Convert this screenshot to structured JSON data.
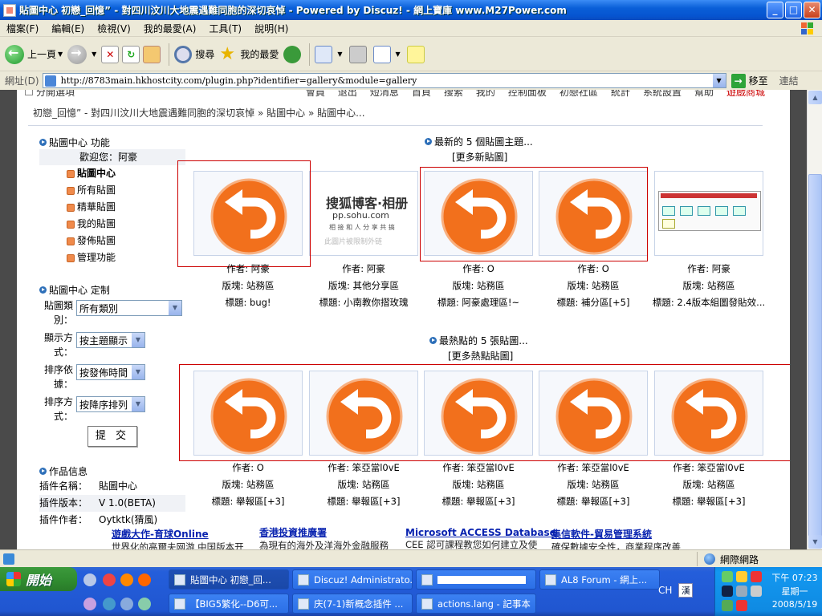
{
  "window": {
    "title": "貼圖中心 初戀_回憶” - 對四川汶川大地震遇難同胞的深切哀悼 - Powered by Discuz! - 網上寶庫 www.M27Power.com",
    "min": "_",
    "max": "□",
    "close": "✕"
  },
  "menu": [
    "檔案(F)",
    "編輯(E)",
    "檢視(V)",
    "我的最愛(A)",
    "工具(T)",
    "說明(H)"
  ],
  "toolbar": {
    "back": "上一頁",
    "search": "搜尋",
    "favorites": "我的最愛"
  },
  "address": {
    "label": "網址(D)",
    "url": "http://8783main.hkhostcity.com/plugin.php?identifier=gallery&module=gallery",
    "go": "移至",
    "links": "連結"
  },
  "topnav": {
    "left": "分開選項",
    "items": [
      "會員",
      "退出",
      "短消息",
      "首頁",
      "搜索",
      "我的",
      "控制面板",
      "初戀社區",
      "統計",
      "系統設置",
      "幫助"
    ],
    "highlight": "遊戲商城"
  },
  "breadcrumb": "初戀_回憶” - 對四川汶川大地震遇難同胞的深切哀悼 » 貼圖中心 » 貼圖中心...",
  "sidebar": {
    "functions_title": "貼圖中心 功能",
    "welcome": "歡迎您：阿豪",
    "links": [
      "貼圖中心",
      "所有貼圖",
      "精華貼圖",
      "我的貼圖",
      "發佈貼圖",
      "管理功能"
    ],
    "custom_title": "貼圖中心 定制",
    "form": [
      {
        "label": "貼圖類別：",
        "value": "所有類別"
      },
      {
        "label": "顯示方式：",
        "value": "按主題顯示"
      },
      {
        "label": "排序依據：",
        "value": "按發佈時間"
      },
      {
        "label": "排序方式：",
        "value": "按降序排列"
      }
    ],
    "submit": "提 交",
    "info_title": "作品信息",
    "info": [
      {
        "k": "插件名稱：",
        "v": "貼圖中心"
      },
      {
        "k": "插件版本：",
        "v": "V 1.0(BETA)"
      },
      {
        "k": "插件作者：",
        "v": "Oytktk(猜風)"
      }
    ]
  },
  "latest": {
    "title": "最新的 5 個貼圖主題...",
    "more": "[更多新貼圖]",
    "items": [
      {
        "author": "作者: 阿豪",
        "board": "版塊: 站務區",
        "subject": "標題: bug!"
      },
      {
        "author": "作者: 阿豪",
        "board": "版塊: 其他分享區",
        "subject": "標題: 小南教你摺玫瑰"
      },
      {
        "author": "作者: O",
        "board": "版塊: 站務區",
        "subject": "標題: 阿豪處理區!~"
      },
      {
        "author": "作者: O",
        "board": "版塊: 站務區",
        "subject": "標題: 補分區[+5]"
      },
      {
        "author": "作者: 阿豪",
        "board": "版塊: 站務區",
        "subject": "標題: 2.4版本組圖發貼效..."
      }
    ],
    "sohu": {
      "l1": "搜狐博客·相册",
      "l2": "pp.sohu.com",
      "l3": "相 接 和 人 分 享 共 搞",
      "l4": "此圖片被限制外链"
    }
  },
  "hot": {
    "title": "最熱點的 5 張貼圖...",
    "more": "[更多熱點貼圖]",
    "items": [
      {
        "author": "作者: O",
        "board": "版塊: 站務區",
        "subject": "標題: 舉報區[+3]"
      },
      {
        "author": "作者: 笨亞當l0vE",
        "board": "版塊: 站務區",
        "subject": "標題: 舉報區[+3]"
      },
      {
        "author": "作者: 笨亞當l0vE",
        "board": "版塊: 站務區",
        "subject": "標題: 舉報區[+3]"
      },
      {
        "author": "作者: 笨亞當l0vE",
        "board": "版塊: 站務區",
        "subject": "標題: 舉報區[+3]"
      },
      {
        "author": "作者: 笨亞當l0vE",
        "board": "版塊: 站務區",
        "subject": "標題: 舉報區[+3]"
      }
    ]
  },
  "ads": [
    {
      "h": "遊戲大作-育球Online",
      "d": "世界化的高爾夫网游 中国版本开"
    },
    {
      "h": "香港投資推廣署",
      "d": "為現有的海外及洋海外金融服務"
    },
    {
      "h": "Microsoft ACCESS Database",
      "d": "CEE 認可課程教您如何建立及使"
    },
    {
      "h": "集信軟件-貿易管理系統",
      "d": "確保數據安全性，商業程序改善"
    }
  ],
  "status": {
    "zone": "網際網路"
  },
  "taskbar": {
    "start": "開始",
    "row1": [
      "貼圖中心 初戀_回...",
      "Discuz! Administrato...",
      "",
      "AL8 Forum - 網上..."
    ],
    "row2": [
      "【BIG5繁化--D6可...",
      "庆(7-1)新概念插件 ...",
      "actions.lang - 記事本"
    ],
    "lang": "CH",
    "time": "下午 07:23",
    "weekday": "星期一",
    "date": "2008/5/19"
  }
}
